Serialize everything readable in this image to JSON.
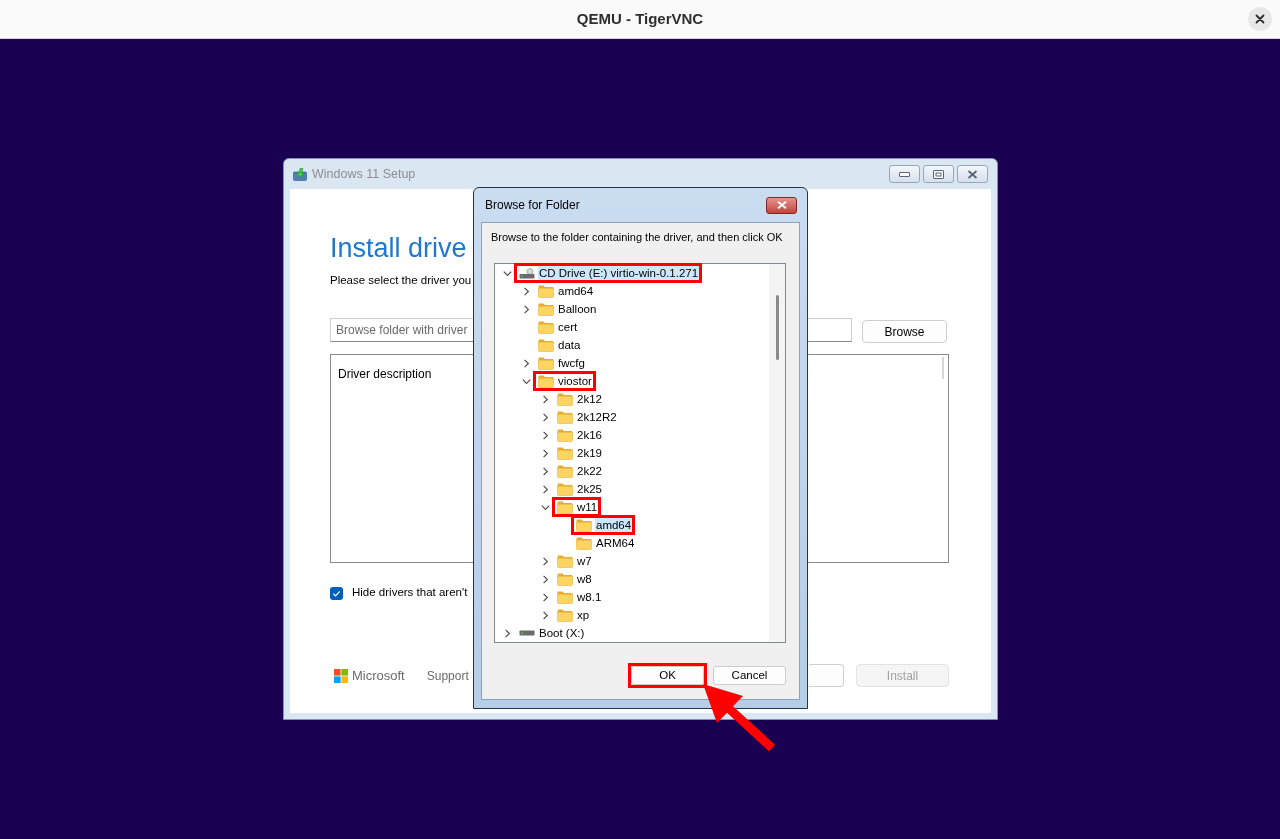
{
  "viewer": {
    "title": "QEMU - TigerVNC"
  },
  "setup_window": {
    "title": "Windows 11 Setup",
    "heading": "Install drive",
    "subtitle": "Please select the driver you",
    "folder_field": {
      "placeholder": "Browse folder with driver"
    },
    "browse_button": {
      "label": "Browse"
    },
    "driver_list": {
      "header": "Driver description"
    },
    "hide_option": {
      "label": "Hide drivers that aren't",
      "checked": true
    },
    "footer": {
      "brand": "Microsoft",
      "link": "Support"
    },
    "install_button": {
      "label": "Install",
      "disabled": true
    }
  },
  "dialog": {
    "title": "Browse for Folder",
    "instruction": "Browse to the folder containing the driver, and then click OK",
    "tree": [
      {
        "kind": "cd_drive",
        "label": "CD Drive (E:) virtio-win-0.1.271",
        "expanded": true,
        "selected": true,
        "annotated": true,
        "children": [
          {
            "kind": "folder",
            "label": "amd64",
            "expanded": false,
            "selected": false,
            "annotated": false
          },
          {
            "kind": "folder",
            "label": "Balloon",
            "expanded": false,
            "selected": false,
            "annotated": false
          },
          {
            "kind": "folder",
            "label": "cert",
            "selected": false,
            "annotated": false
          },
          {
            "kind": "folder",
            "label": "data",
            "selected": false,
            "annotated": false
          },
          {
            "kind": "folder",
            "label": "fwcfg",
            "expanded": false,
            "selected": false,
            "annotated": false
          },
          {
            "kind": "folder",
            "label": "viostor",
            "expanded": true,
            "selected": false,
            "annotated": true,
            "children": [
              {
                "kind": "folder",
                "label": "2k12",
                "expanded": false,
                "selected": false,
                "annotated": false
              },
              {
                "kind": "folder",
                "label": "2k12R2",
                "expanded": false,
                "selected": false,
                "annotated": false
              },
              {
                "kind": "folder",
                "label": "2k16",
                "expanded": false,
                "selected": false,
                "annotated": false
              },
              {
                "kind": "folder",
                "label": "2k19",
                "expanded": false,
                "selected": false,
                "annotated": false
              },
              {
                "kind": "folder",
                "label": "2k22",
                "expanded": false,
                "selected": false,
                "annotated": false
              },
              {
                "kind": "folder",
                "label": "2k25",
                "expanded": false,
                "selected": false,
                "annotated": false
              },
              {
                "kind": "folder",
                "label": "w11",
                "expanded": true,
                "selected": false,
                "annotated": true,
                "children": [
                  {
                    "kind": "folder",
                    "label": "amd64",
                    "selected": true,
                    "annotated": true
                  },
                  {
                    "kind": "folder",
                    "label": "ARM64",
                    "selected": false,
                    "annotated": false
                  }
                ]
              },
              {
                "kind": "folder",
                "label": "w7",
                "expanded": false,
                "selected": false,
                "annotated": false
              },
              {
                "kind": "folder",
                "label": "w8",
                "expanded": false,
                "selected": false,
                "annotated": false
              },
              {
                "kind": "folder",
                "label": "w8.1",
                "expanded": false,
                "selected": false,
                "annotated": false
              },
              {
                "kind": "folder",
                "label": "xp",
                "expanded": false,
                "selected": false,
                "annotated": false
              }
            ]
          }
        ]
      },
      {
        "kind": "drive",
        "label": "Boot (X:)",
        "expanded": false,
        "selected": false,
        "annotated": false
      }
    ],
    "buttons": [
      {
        "label": "OK",
        "annotated": true
      },
      {
        "label": "Cancel",
        "annotated": false
      }
    ],
    "pointer_arrow": true
  }
}
